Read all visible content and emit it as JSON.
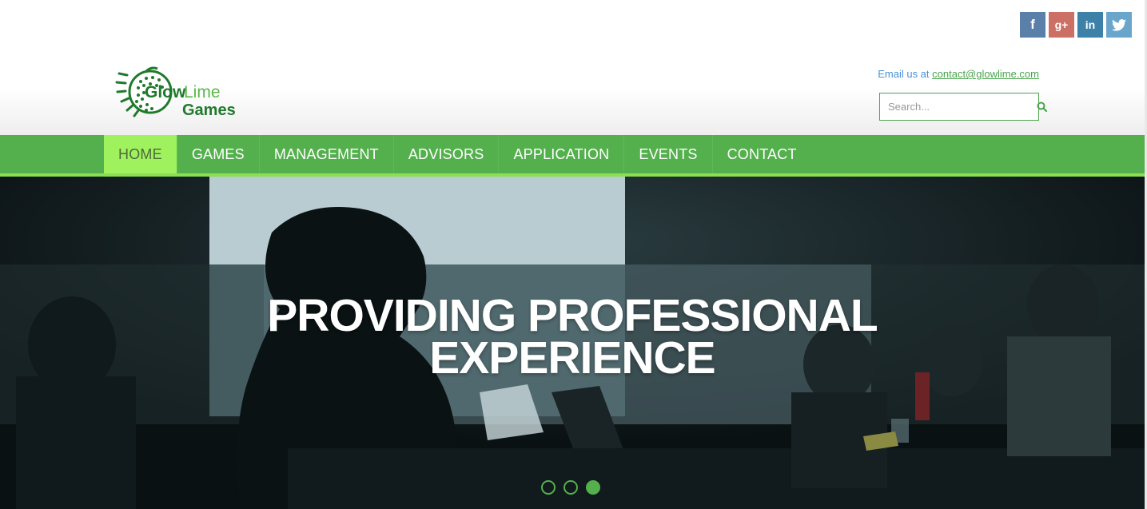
{
  "social": [
    {
      "name": "facebook",
      "glyph": "f"
    },
    {
      "name": "google-plus",
      "glyph": "g+"
    },
    {
      "name": "linkedin",
      "glyph": "in"
    },
    {
      "name": "twitter",
      "glyph": "t"
    }
  ],
  "logo": {
    "line1_a": "Glow",
    "line1_b": "Lime",
    "line2": "Games"
  },
  "contact": {
    "prefix": "Email us at ",
    "email": "contact@glowlime.com"
  },
  "search": {
    "placeholder": "Search...",
    "icon": "search-icon"
  },
  "nav": {
    "items": [
      {
        "label": "HOME",
        "active": true
      },
      {
        "label": "GAMES"
      },
      {
        "label": "MANAGEMENT"
      },
      {
        "label": "ADVISORS"
      },
      {
        "label": "APPLICATION"
      },
      {
        "label": "EVENTS"
      },
      {
        "label": "CONTACT"
      }
    ]
  },
  "hero": {
    "title_line1": "PROVIDING PROFESSIONAL",
    "title_line2": "EXPERIENCE",
    "slides": 3,
    "active_slide": 3
  },
  "colors": {
    "nav_green": "#53b04c",
    "nav_active": "#9ff25e",
    "accent_line": "#8ae052",
    "brand_dark_green": "#1f7a2c"
  }
}
